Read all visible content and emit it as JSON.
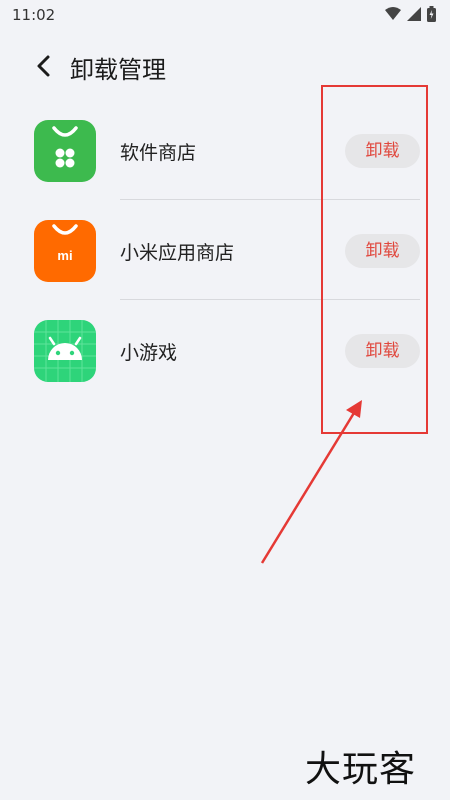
{
  "status_bar": {
    "time": "11:02"
  },
  "header": {
    "title": "卸载管理"
  },
  "apps": [
    {
      "name": "软件商店",
      "button": "卸载",
      "icon_color": "#3dba4e"
    },
    {
      "name": "小米应用商店",
      "button": "卸载",
      "icon_color": "#ff6a00"
    },
    {
      "name": "小游戏",
      "button": "卸载",
      "icon_color": "#2ed47a"
    }
  ],
  "watermark": "大玩客",
  "colors": {
    "accent_red": "#e0483e",
    "background": "#f2f3f7"
  }
}
